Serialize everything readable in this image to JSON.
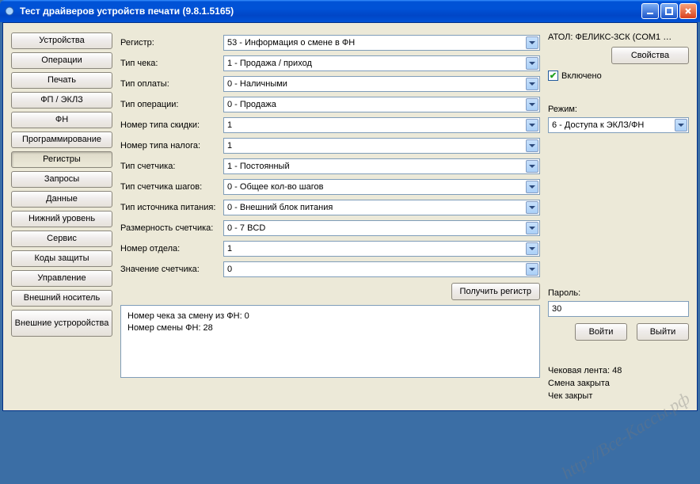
{
  "window": {
    "title": "Тест драйверов устройств печати (9.8.1.5165)"
  },
  "sidebar": {
    "items": [
      "Устройства",
      "Операции",
      "Печать",
      "ФП / ЭКЛЗ",
      "ФН",
      "Программирование",
      "Регистры",
      "Запросы",
      "Данные",
      "Нижний уровень",
      "Сервис",
      "Коды защиты",
      "Управление",
      "Внешний носитель",
      "Внешние устроройства"
    ],
    "active_index": 6
  },
  "form": {
    "rows": [
      {
        "label": "Регистр:",
        "value": "53 - Информация о смене в ФН"
      },
      {
        "label": "Тип чека:",
        "value": "1 - Продажа / приход"
      },
      {
        "label": "Тип оплаты:",
        "value": "0 - Наличными"
      },
      {
        "label": "Тип операции:",
        "value": "0 - Продажа"
      },
      {
        "label": "Номер типа скидки:",
        "value": "1"
      },
      {
        "label": "Номер типа налога:",
        "value": "1"
      },
      {
        "label": "Тип счетчика:",
        "value": "1 - Постоянный"
      },
      {
        "label": "Тип счетчика шагов:",
        "value": "0 - Общее кол-во шагов"
      },
      {
        "label": "Тип источника питания:",
        "value": "0 - Внешний блок питания"
      },
      {
        "label": "Размерность счетчика:",
        "value": "0 - 7 BCD"
      },
      {
        "label": "Номер отдела:",
        "value": "1"
      },
      {
        "label": "Значение счетчика:",
        "value": "0"
      }
    ],
    "get_register_btn": "Получить регистр",
    "result_text": "Номер чека за смену из ФН: 0\nНомер смены ФН: 28"
  },
  "right": {
    "device_name": "АТОЛ: ФЕЛИКС-3СК (COM1 …",
    "properties_btn": "Свойства",
    "enabled_label": "Включено",
    "mode_label": "Режим:",
    "mode_value": "6 - Доступа к ЭКЛЗ/ФН",
    "password_label": "Пароль:",
    "password_value": "30",
    "login_btn": "Войти",
    "logout_btn": "Выйти",
    "status": [
      "Чековая лента: 48",
      "Смена закрыта",
      "Чек закрыт"
    ]
  },
  "watermark": "http://Все-Кассы.рф"
}
